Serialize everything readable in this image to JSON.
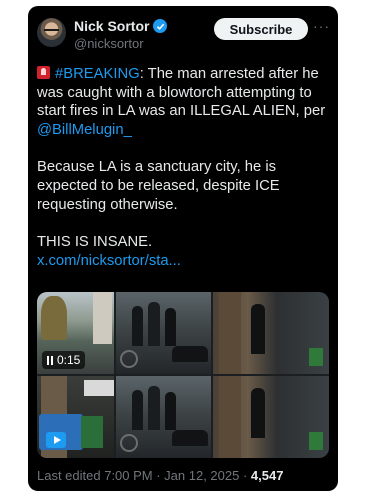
{
  "author": {
    "display_name": "Nick Sortor",
    "handle": "@nicksortor",
    "verified_icon": "verified-badge-icon",
    "avatar_icon": "profile-photo"
  },
  "header": {
    "subscribe_label": "Subscribe",
    "more_label": "···"
  },
  "tweet": {
    "siren_icon": "siren-emoji-icon",
    "hashtag": "#BREAKING",
    "line1_rest": ": The man arrested after he was caught with a blowtorch attempting to start fires in LA was an ILLEGAL ALIEN, per ",
    "mention": "@BillMelugin_",
    "para2": "Because LA is a sanctuary city, he is expected to be released, despite ICE requesting otherwise.",
    "para3": "THIS IS INSANE.",
    "link": "x.com/nicksortor/sta..."
  },
  "media": {
    "video_duration": "0:15",
    "pause_icon": "pause-icon",
    "play_icon": "video-play-icon"
  },
  "footer": {
    "edited_text": "Last edited 7:00 PM · Jan 12, 2025 · ",
    "views": "4,547"
  },
  "colors": {
    "background": "#000000",
    "text": "#e7e9ea",
    "muted": "#71767b",
    "accent": "#1d9bf0",
    "siren": "#d2222d"
  }
}
